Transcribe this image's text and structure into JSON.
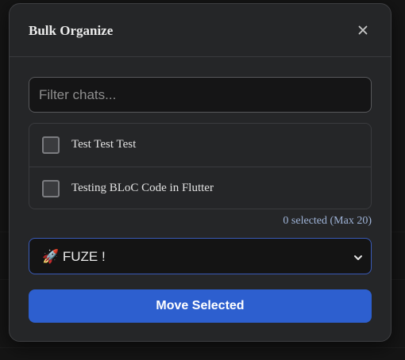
{
  "modal": {
    "title": "Bulk Organize",
    "close_icon": "close-icon"
  },
  "filter": {
    "placeholder": "Filter chats...",
    "value": ""
  },
  "chats": [
    {
      "label": "Test Test Test",
      "checked": false
    },
    {
      "label": "Testing BLoC Code in Flutter",
      "checked": false
    }
  ],
  "selection": {
    "count_text": "0 selected (Max 20)"
  },
  "folder_select": {
    "selected": "🚀 FUZE !",
    "icon": "chevron-down-icon"
  },
  "actions": {
    "move_label": "Move Selected"
  },
  "colors": {
    "modal_bg": "#252628",
    "accent": "#2d5fcf",
    "select_border": "#3a5bb8",
    "count_text": "#9fb4d8"
  }
}
